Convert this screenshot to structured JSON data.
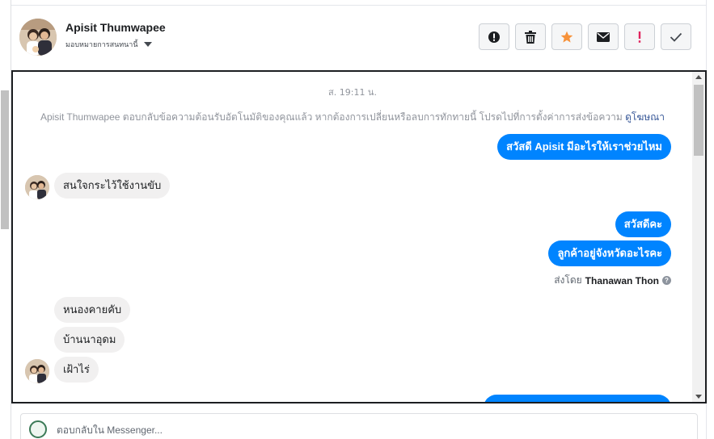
{
  "header": {
    "contact_name": "Apisit Thumwapee",
    "assign_label": "มอบหมายการสนทนานี้",
    "actions": [
      {
        "icon": "alert-circle-icon",
        "color": "#1c1e21"
      },
      {
        "icon": "trash-icon",
        "color": "#1c1e21"
      },
      {
        "icon": "star-icon",
        "color": "#f7923a"
      },
      {
        "icon": "envelope-icon",
        "color": "#1c1e21"
      },
      {
        "icon": "exclamation-icon",
        "color": "#e0245e"
      },
      {
        "icon": "check-icon",
        "color": "#1c1e21"
      }
    ]
  },
  "chat": {
    "timestamp": "ส. 19:11 น.",
    "notice_text": "Apisit Thumwapee ตอบกลับข้อความต้อนรับอัตโนมัติของคุณแล้ว หากต้องการเปลี่ยนหรือลบการทักทายนี้ โปรดไปที่การตั้งค่าการส่งข้อความ",
    "notice_link": "ดูโฆษณา",
    "messages": {
      "out_1": "สวัสดี Apisit มีอะไรให้เราช่วยไหม",
      "in_1": "สนใจกระไว้ใช้งานขับ",
      "out_2": "สวัสดีคะ",
      "out_3": "ลูกค้าอยู่จังหวัดอะไรคะ",
      "in_2": "หนองคายคับ",
      "in_3": "บ้านนาอุดม",
      "in_4": "เฝ้าไร่"
    },
    "sent_by_label": "ส่งโดย",
    "sent_by_agent": "Thanawan Thon"
  },
  "reply": {
    "placeholder": "ตอบกลับใน Messenger..."
  },
  "colors": {
    "outgoing_bubble": "#0084ff",
    "incoming_bubble": "#f1f0f0",
    "link": "#385898"
  }
}
